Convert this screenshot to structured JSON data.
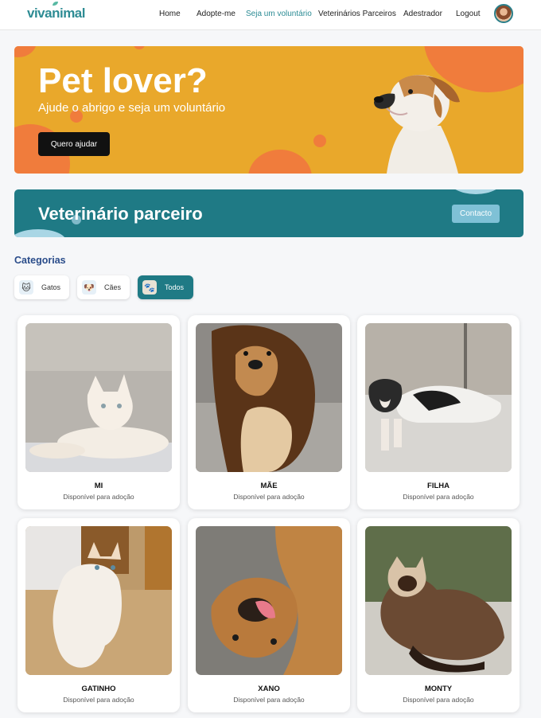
{
  "nav": {
    "logo": "vivanimal",
    "links": [
      "Home",
      "Adopte-me",
      "Seja um voluntário",
      "Veterinários Parceiros",
      "Adestrador",
      "Logout"
    ],
    "active_link": "Seja um voluntário"
  },
  "hero": {
    "title": "Pet lover?",
    "subtitle": "Ajude o abrigo e seja um voluntário",
    "button": "Quero ajudar"
  },
  "vet_banner": {
    "title": "Veterinário parceiro",
    "button": "Contacto"
  },
  "categories": {
    "title": "Categorias",
    "items": [
      {
        "label": "Gatos",
        "icon": "cat-icon"
      },
      {
        "label": "Cães",
        "icon": "dog-icon"
      },
      {
        "label": "Todos",
        "icon": "all-pets-icon",
        "selected": true
      }
    ]
  },
  "pets": [
    {
      "name": "MI",
      "status": "Disponível para adoção"
    },
    {
      "name": "MÃE",
      "status": "Disponível para adoção"
    },
    {
      "name": "FILHA",
      "status": "Disponível para adoção"
    },
    {
      "name": "GATINHO",
      "status": "Disponível para adoção"
    },
    {
      "name": "XANO",
      "status": "Disponível para adoção"
    },
    {
      "name": "MONTY",
      "status": "Disponível para adoção"
    }
  ],
  "colors": {
    "accent": "#1f7a85",
    "hero_bg": "#e9a82b",
    "hero_circles": "#f07c3c",
    "categories_title": "#2a4c8a"
  }
}
